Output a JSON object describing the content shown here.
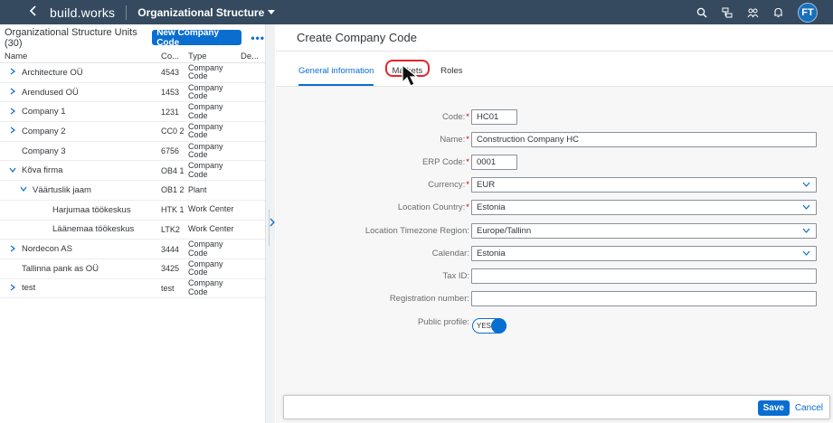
{
  "shell": {
    "back_icon": "chevron-left-icon",
    "brand": "build.works",
    "app_title": "Organizational Structure",
    "avatar_initials": "FT",
    "icons": [
      "search-icon",
      "tree-icon",
      "people-icon",
      "bell-icon"
    ]
  },
  "left": {
    "title": "Organizational Structure Units (30)",
    "new_button": "New Company Code",
    "more": "•••",
    "columns": [
      "Name",
      "Co...",
      "Type",
      "De..."
    ],
    "rows": [
      {
        "indent": 0,
        "expand": "right",
        "name": "Architecture OÜ",
        "code": "4543",
        "type": "Company Code"
      },
      {
        "indent": 0,
        "expand": "right",
        "name": "Arendused OÜ",
        "code": "1453",
        "type": "Company Code"
      },
      {
        "indent": 0,
        "expand": "right",
        "name": "Company 1",
        "code": "1231",
        "type": "Company Code"
      },
      {
        "indent": 0,
        "expand": "right",
        "name": "Company 2",
        "code": "CC0 2",
        "type": "Company Code"
      },
      {
        "indent": 0,
        "expand": "none",
        "name": "Company 3",
        "code": "6756",
        "type": "Company Code"
      },
      {
        "indent": 0,
        "expand": "down",
        "name": "Kõva firma",
        "code": "OB4 1",
        "type": "Company Code"
      },
      {
        "indent": 1,
        "expand": "down",
        "name": "Väärtuslik jaam",
        "code": "OB1 2",
        "type": "Plant"
      },
      {
        "indent": 2,
        "expand": "none",
        "name": "Harjumaa töökeskus",
        "code": "HTK 1",
        "type": "Work Center"
      },
      {
        "indent": 2,
        "expand": "none",
        "name": "Läänemaa töökeskus",
        "code": "LTK2",
        "type": "Work Center"
      },
      {
        "indent": 0,
        "expand": "right",
        "name": "Nordecon AS",
        "code": "3444",
        "type": "Company Code"
      },
      {
        "indent": 0,
        "expand": "none",
        "name": "Tallinna pank as OÜ",
        "code": "3425",
        "type": "Company Code"
      },
      {
        "indent": 0,
        "expand": "right",
        "name": "test",
        "code": "test",
        "type": "Company Code"
      }
    ]
  },
  "main": {
    "title": "Create Company Code",
    "tabs": [
      {
        "label": "General information",
        "active": true
      },
      {
        "label": "Markets",
        "active": false
      },
      {
        "label": "Roles",
        "active": false
      }
    ],
    "form": {
      "code": {
        "label": "Code:",
        "required": true,
        "value": "HC01"
      },
      "name": {
        "label": "Name:",
        "required": true,
        "value": "Construction Company HC"
      },
      "erp": {
        "label": "ERP Code:",
        "required": true,
        "value": "0001"
      },
      "currency": {
        "label": "Currency:",
        "required": true,
        "value": "EUR"
      },
      "country": {
        "label": "Location Country:",
        "required": true,
        "value": "Estonia"
      },
      "timezone": {
        "label": "Location Timezone Region:",
        "required": false,
        "value": "Europe/Tallinn"
      },
      "calendar": {
        "label": "Calendar:",
        "required": false,
        "value": "Estonia"
      },
      "taxid": {
        "label": "Tax ID:",
        "required": false,
        "value": ""
      },
      "regnum": {
        "label": "Registration number:",
        "required": false,
        "value": ""
      },
      "public": {
        "label": "Public profile:",
        "required": false,
        "value": "YES"
      }
    },
    "footer": {
      "save": "Save",
      "cancel": "Cancel"
    }
  },
  "colors": {
    "shell": "#354a5f",
    "accent": "#0a6ed1",
    "highlight": "#e3262b",
    "required": "#d50000"
  }
}
